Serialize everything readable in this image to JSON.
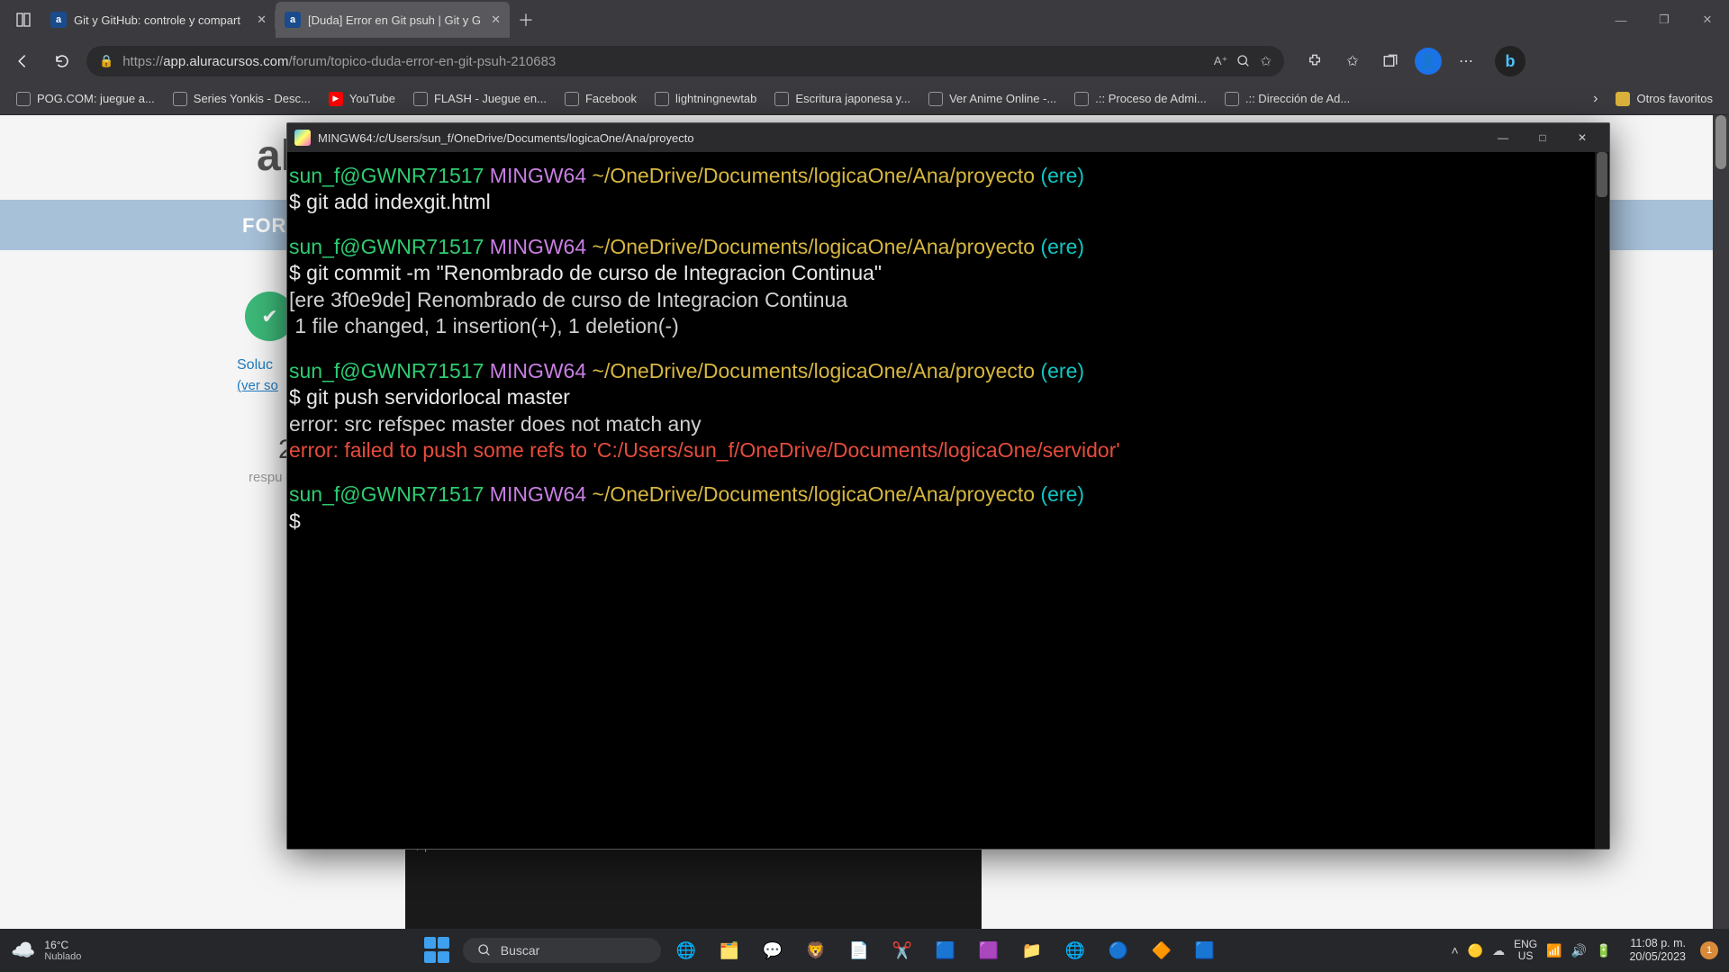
{
  "browser": {
    "tabs": [
      {
        "title": "Git y GitHub: controle y compart",
        "fav": "a"
      },
      {
        "title": "[Duda] Error en Git psuh | Git y G",
        "fav": "a"
      }
    ],
    "url_host": "app.aluracursos.com",
    "url_path": "/forum/topico-duda-error-en-git-psuh-210683",
    "bookmarks": [
      "POG.COM: juegue a...",
      "Series Yonkis - Desc...",
      "YouTube",
      "FLASH - Juegue en...",
      "Facebook",
      "lightningnewtab",
      "Escritura japonesa y...",
      "Ver Anime Online -...",
      ".:: Proceso de Admi...",
      ".:: Dirección de Ad..."
    ],
    "other_favs": "Otros favoritos"
  },
  "background_page": {
    "logo_letter": "al",
    "foro_label": "FOR",
    "solucionado": "Soluc",
    "ver_solucion": "(ver so",
    "big_two": "2",
    "respuestas": "respu",
    "mini_term_line1": "$ |"
  },
  "terminal": {
    "title": "MINGW64:/c/Users/sun_f/OneDrive/Documents/logicaOne/Ana/proyecto",
    "prompt_user": "sun_f@GWNR71517",
    "prompt_env": "MINGW64",
    "prompt_path": "~/OneDrive/Documents/logicaOne/Ana/proyecto",
    "prompt_branch": "(ere)",
    "blocks": [
      {
        "cmd": "git add indexgit.html",
        "out": []
      },
      {
        "cmd": "git commit -m \"Renombrado de curso de Integracion Continua\"",
        "out": [
          "[ere 3f0e9de] Renombrado de curso de Integracion Continua",
          " 1 file changed, 1 insertion(+), 1 deletion(-)"
        ]
      },
      {
        "cmd": "git push servidorlocal master",
        "out": [
          "error: src refspec master does not match any"
        ],
        "err": [
          "error: failed to push some refs to 'C:/Users/sun_f/OneDrive/Documents/logicaOne/servidor'"
        ]
      },
      {
        "cmd": "",
        "out": []
      }
    ]
  },
  "taskbar": {
    "temp": "16°C",
    "weather": "Nublado",
    "search_placeholder": "Buscar",
    "lang1": "ENG",
    "lang2": "US",
    "time": "11:08 p. m.",
    "date": "20/05/2023",
    "notif_count": "1"
  }
}
